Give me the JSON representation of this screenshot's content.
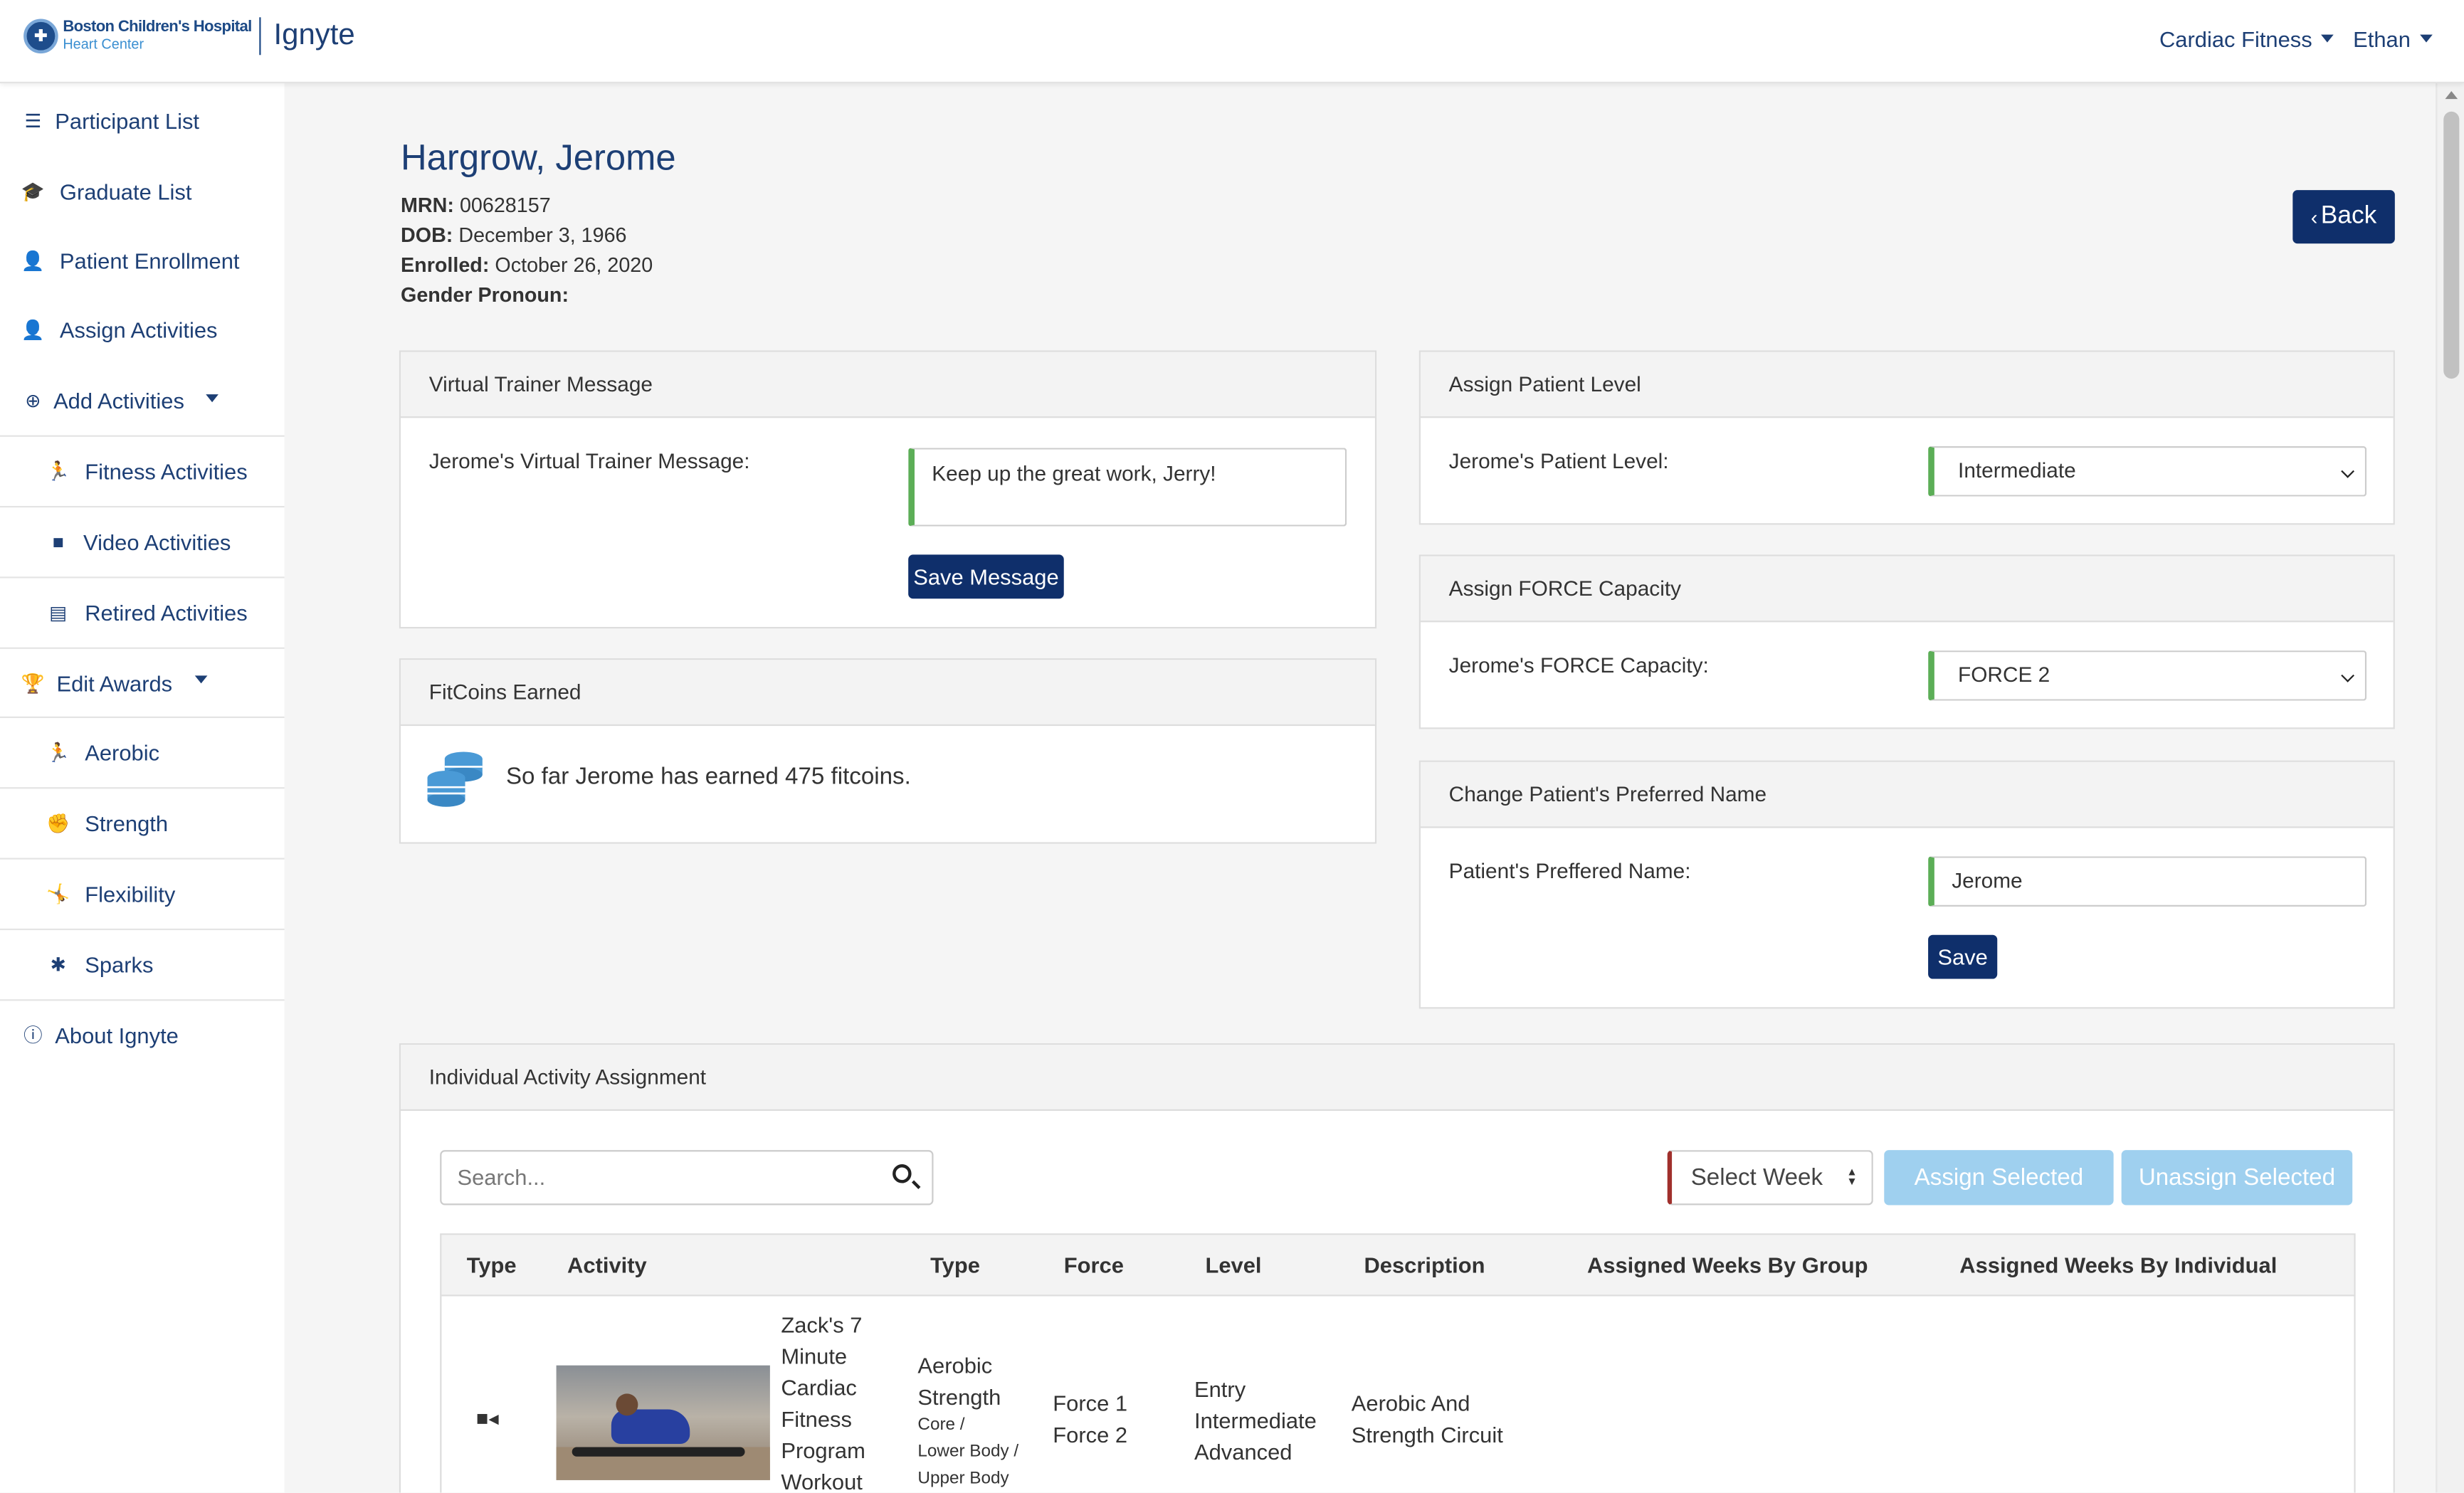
{
  "header": {
    "logo_line1": "Boston Children's Hospital",
    "logo_line2": "Heart Center",
    "app_name": "Ignyte",
    "program_menu": "Cardiac Fitness",
    "user_menu": "Ethan"
  },
  "sidebar": {
    "items": [
      {
        "label": "Participant List",
        "icon": "list-icon"
      },
      {
        "label": "Graduate List",
        "icon": "graduation-cap-icon"
      },
      {
        "label": "Patient Enrollment",
        "icon": "user-plus-icon"
      },
      {
        "label": "Assign Activities",
        "icon": "user-check-icon"
      },
      {
        "label": "Add Activities",
        "icon": "plus-circle-icon"
      },
      {
        "label": "Fitness Activities",
        "icon": "running-icon"
      },
      {
        "label": "Video Activities",
        "icon": "video-icon"
      },
      {
        "label": "Retired Activities",
        "icon": "archive-icon"
      },
      {
        "label": "Edit Awards",
        "icon": "trophy-icon"
      },
      {
        "label": "Aerobic",
        "icon": "running-icon"
      },
      {
        "label": "Strength",
        "icon": "fist-icon"
      },
      {
        "label": "Flexibility",
        "icon": "stretch-icon"
      },
      {
        "label": "Sparks",
        "icon": "sparks-icon"
      },
      {
        "label": "About Ignyte",
        "icon": "info-icon"
      }
    ]
  },
  "patient": {
    "name": "Hargrow, Jerome",
    "mrn_label": "MRN:",
    "mrn": "00628157",
    "dob_label": "DOB:",
    "dob": "December 3, 1966",
    "enrolled_label": "Enrolled:",
    "enrolled": "October 26, 2020",
    "pronoun_label": "Gender Pronoun:",
    "pronoun": ""
  },
  "back_label": "Back",
  "trainer": {
    "title": "Virtual Trainer Message",
    "label": "Jerome's Virtual Trainer Message:",
    "value": "Keep up the great work, Jerry!",
    "save_label": "Save Message"
  },
  "fitcoins": {
    "title": "FitCoins Earned",
    "text": "So far Jerome has earned 475 fitcoins."
  },
  "level": {
    "title": "Assign Patient Level",
    "label": "Jerome's Patient Level:",
    "value": "Intermediate"
  },
  "force": {
    "title": "Assign FORCE Capacity",
    "label": "Jerome's FORCE Capacity:",
    "value": "FORCE 2"
  },
  "preferred": {
    "title": "Change Patient's Preferred Name",
    "label": "Patient's Preffered Name:",
    "value": "Jerome",
    "save_label": "Save"
  },
  "assignment": {
    "title": "Individual Activity Assignment",
    "search_placeholder": "Search...",
    "week_select": "Select Week",
    "assign_label": "Assign Selected",
    "unassign_label": "Unassign Selected",
    "columns": [
      "Type",
      "Activity",
      "Type",
      "Force",
      "Level",
      "Description",
      "Assigned Weeks By Group",
      "Assigned Weeks By Individual"
    ],
    "rows": [
      {
        "type_icon": "video-icon",
        "activity": [
          "Zack's 7",
          "Minute",
          "Cardiac",
          "Fitness",
          "Program",
          "Workout"
        ],
        "types": [
          "Aerobic",
          "Strength"
        ],
        "subtypes": [
          "Core /",
          "Lower Body /",
          "Upper Body"
        ],
        "force": [
          "Force 1",
          "Force 2"
        ],
        "level": [
          "Entry",
          "Intermediate",
          "Advanced"
        ],
        "description": [
          "Aerobic And",
          "Strength Circuit"
        ]
      }
    ]
  }
}
